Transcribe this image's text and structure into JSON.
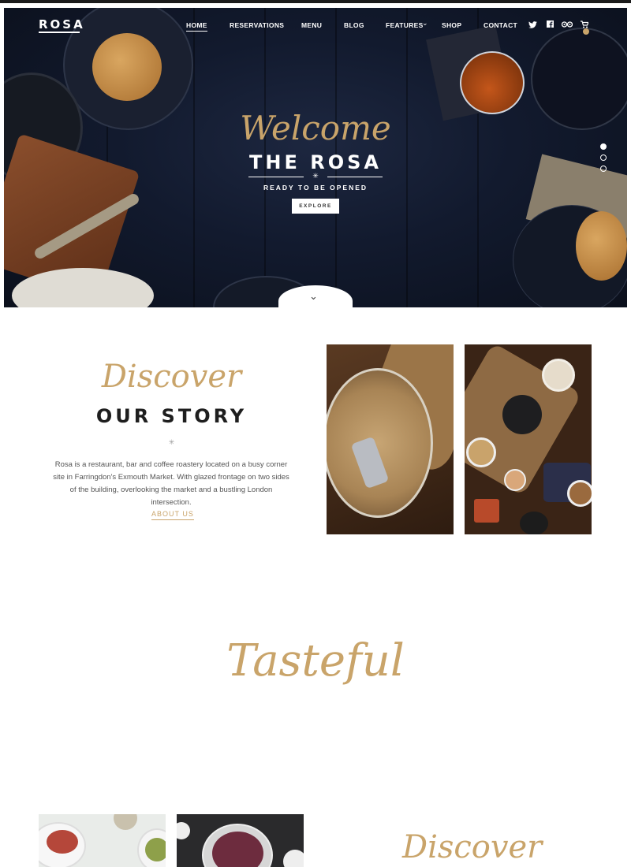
{
  "nav": {
    "logo": "ROSA",
    "items": [
      "HOME",
      "RESERVATIONS",
      "MENU",
      "BLOG",
      "FEATURES",
      "SHOP",
      "CONTACT"
    ],
    "features_caret": "⌄",
    "icons": [
      "twitter-icon",
      "facebook-icon",
      "tripadvisor-icon",
      "cart-icon"
    ]
  },
  "hero": {
    "script": "Welcome",
    "title": "THE ROSA",
    "ornament": "✳",
    "subtitle": "READY TO BE OPENED",
    "button": "EXPLORE",
    "scroll_icon": "⌄",
    "slides": 3,
    "active_slide": 1
  },
  "story": {
    "script": "Discover",
    "title": "OUR STORY",
    "ornament": "✳",
    "text": "Rosa is a restaurant, bar and coffee roastery located on a busy corner site in Farringdon's Exmouth Market. With glazed frontage on two sides of the building, overlooking the market and a bustling London intersection.",
    "link": "ABOUT US"
  },
  "section2": {
    "script": "Tasteful"
  },
  "section3": {
    "script": "Discover"
  },
  "colors": {
    "accent": "#c9a46a",
    "hero_bg": "#121a2e",
    "text_dark": "#1e1e1e"
  }
}
